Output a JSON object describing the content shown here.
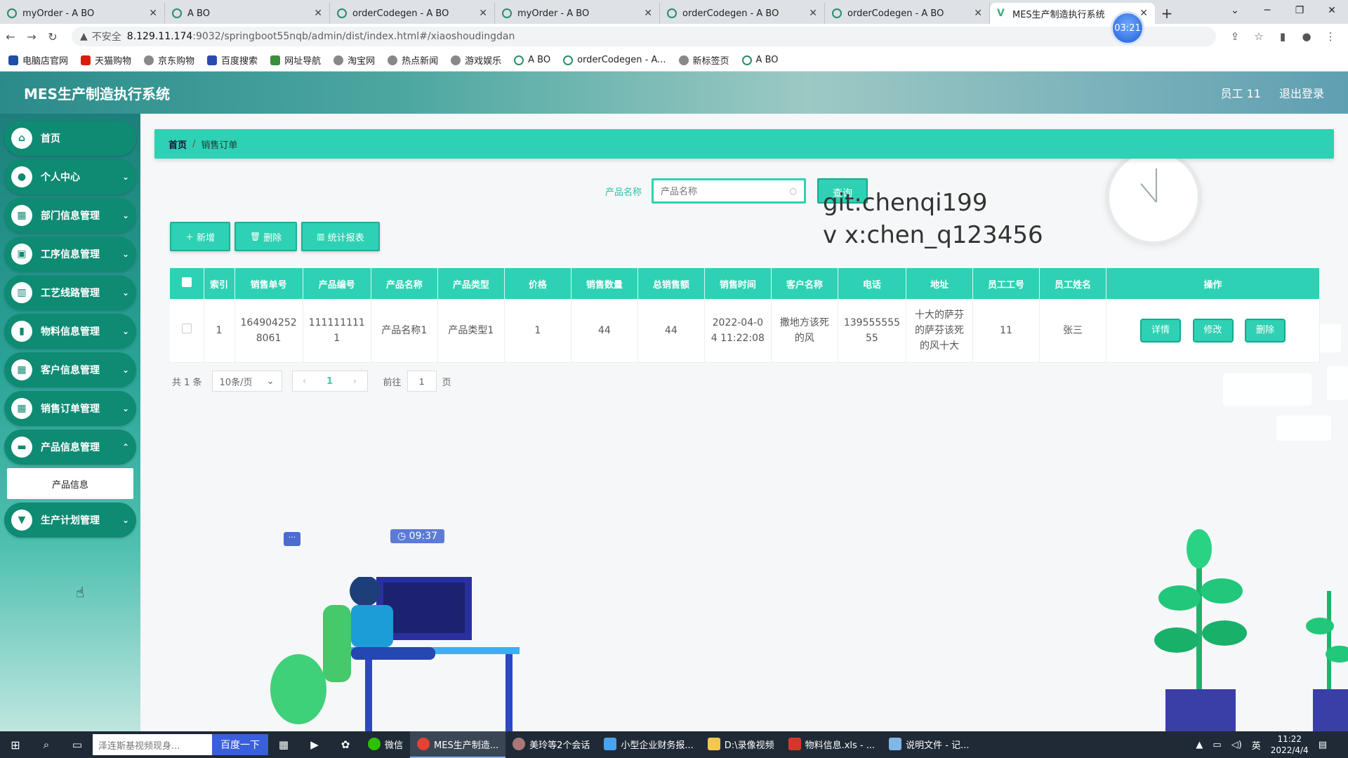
{
  "browser": {
    "tabs": [
      {
        "title": "myOrder - A BO"
      },
      {
        "title": "A BO"
      },
      {
        "title": "orderCodegen - A BO"
      },
      {
        "title": "myOrder - A BO"
      },
      {
        "title": "orderCodegen - A BO"
      },
      {
        "title": "orderCodegen - A BO"
      },
      {
        "title": "MES生产制造执行系统"
      }
    ],
    "recorder_time": "03:21",
    "insecure_label": "不安全",
    "url_host": "8.129.11.174",
    "url_path": ":9032/springboot55nqb/admin/dist/index.html#/xiaoshoudingdan",
    "bookmarks": [
      "电脑店官网",
      "天猫购物",
      "京东购物",
      "百度搜索",
      "网址导航",
      "淘宝网",
      "热点新闻",
      "游戏娱乐",
      "A BO",
      "orderCodegen - A...",
      "新标签页",
      "A BO"
    ]
  },
  "app": {
    "title": "MES生产制造执行系统",
    "user_label": "员工 11",
    "logout_label": "退出登录"
  },
  "sidebar": {
    "items": [
      {
        "label": "首页",
        "icon": "home-icon"
      },
      {
        "label": "个人中心",
        "icon": "user-icon"
      },
      {
        "label": "部门信息管理",
        "icon": "grid-icon"
      },
      {
        "label": "工序信息管理",
        "icon": "briefcase-icon"
      },
      {
        "label": "工艺线路管理",
        "icon": "chart-icon"
      },
      {
        "label": "物料信息管理",
        "icon": "bar-chart-icon"
      },
      {
        "label": "客户信息管理",
        "icon": "grid-icon"
      },
      {
        "label": "销售订单管理",
        "icon": "grid-icon"
      },
      {
        "label": "产品信息管理",
        "icon": "box-icon"
      }
    ],
    "sub_item": "产品信息",
    "last_item": "生产计划管理"
  },
  "breadcrumb": {
    "home": "首页",
    "current": "销售订单"
  },
  "search": {
    "label": "产品名称",
    "placeholder": "产品名称",
    "button": "查询"
  },
  "overlay": {
    "line1": "git:chenqi199",
    "line2": "v x:chen_q123456"
  },
  "actions": {
    "add": "新增",
    "delete": "删除",
    "report": "统计报表"
  },
  "table": {
    "headers": [
      "索引",
      "销售单号",
      "产品编号",
      "产品名称",
      "产品类型",
      "价格",
      "销售数量",
      "总销售额",
      "销售时间",
      "客户名称",
      "电话",
      "地址",
      "员工工号",
      "员工姓名",
      "操作"
    ],
    "rows": [
      {
        "index": "1",
        "order_no_1": "164904252",
        "order_no_2": "8061",
        "product_no_1": "111111111",
        "product_no_2": "1",
        "product_name": "产品名称1",
        "product_type": "产品类型1",
        "price": "1",
        "quantity": "44",
        "total": "44",
        "time_1": "2022-04-0",
        "time_2": "4 11:22:08",
        "customer_1": "撒地方该死",
        "customer_2": "的风",
        "phone_1": "139555555",
        "phone_2": "55",
        "addr_1": "十大的萨芬",
        "addr_2": "的萨芬该死",
        "addr_3": "的风十大",
        "emp_no": "11",
        "emp_name": "张三"
      }
    ],
    "row_buttons": {
      "detail": "详情",
      "edit": "修改",
      "delete": "删除"
    }
  },
  "pagination": {
    "total": "共 1 条",
    "page_size": "10条/页",
    "current": "1",
    "goto_label": "前往",
    "goto_value": "1",
    "goto_suffix": "页"
  },
  "illustration": {
    "timer": "09:37"
  },
  "taskbar": {
    "search_placeholder": "泽连斯基视频现身...",
    "baidu": "百度一下",
    "apps": [
      "微信",
      "MES生产制造...",
      "美玲等2个会话",
      "小型企业财务报...",
      "D:\\录像视频",
      "物料信息.xls - ...",
      "说明文件 - 记..."
    ],
    "time": "11:22",
    "date": "2022/4/4",
    "ime": "英"
  }
}
